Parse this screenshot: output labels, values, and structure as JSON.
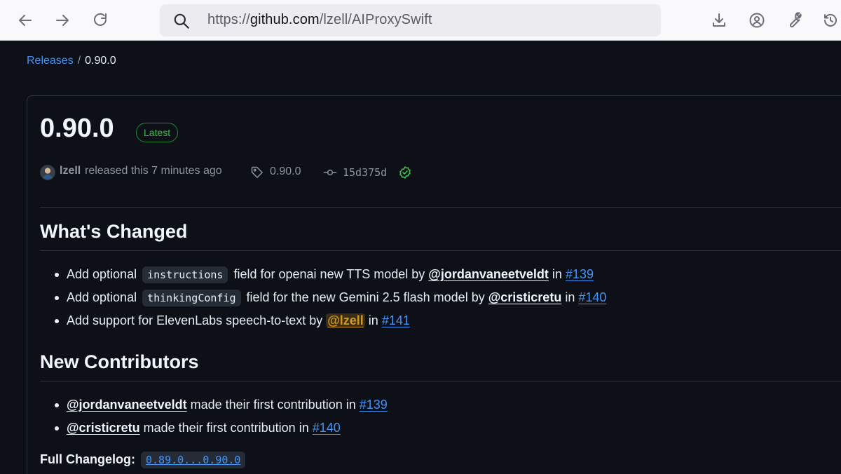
{
  "browser": {
    "url_prefix": "https://",
    "url_host": "github.com",
    "url_path": "/lzell/AIProxySwift"
  },
  "breadcrumb": {
    "parent": "Releases",
    "separator": "/",
    "current": "0.90.0"
  },
  "release": {
    "title": "0.90.0",
    "badge": "Latest",
    "author": "lzell",
    "released_text": "released this 7 minutes ago",
    "tag": "0.90.0",
    "commit": "15d375d"
  },
  "whats_changed": {
    "heading": "What's Changed",
    "items": [
      {
        "pre": "Add optional ",
        "code": "instructions",
        "mid": " field for openai new TTS model by ",
        "user": "@jordanvaneetveldt",
        "in": " in ",
        "pr": "#139"
      },
      {
        "pre": "Add optional ",
        "code": "thinkingConfig",
        "mid": " field for the new Gemini 2.5 flash model by ",
        "user": "@cristicretu",
        "in": " in ",
        "pr": "#140"
      },
      {
        "pre": "Add support for ElevenLabs speech-to-text by ",
        "user": "@lzell",
        "in": " in ",
        "pr": "#141"
      }
    ]
  },
  "new_contributors": {
    "heading": "New Contributors",
    "items": [
      {
        "user": "@jordanvaneetveldt",
        "text": " made their first contribution in ",
        "pr": "#139"
      },
      {
        "user": "@cristicretu",
        "text": " made their first contribution in ",
        "pr": "#140"
      }
    ]
  },
  "changelog": {
    "label": "Full Changelog:",
    "link": "0.89.0...0.90.0"
  }
}
